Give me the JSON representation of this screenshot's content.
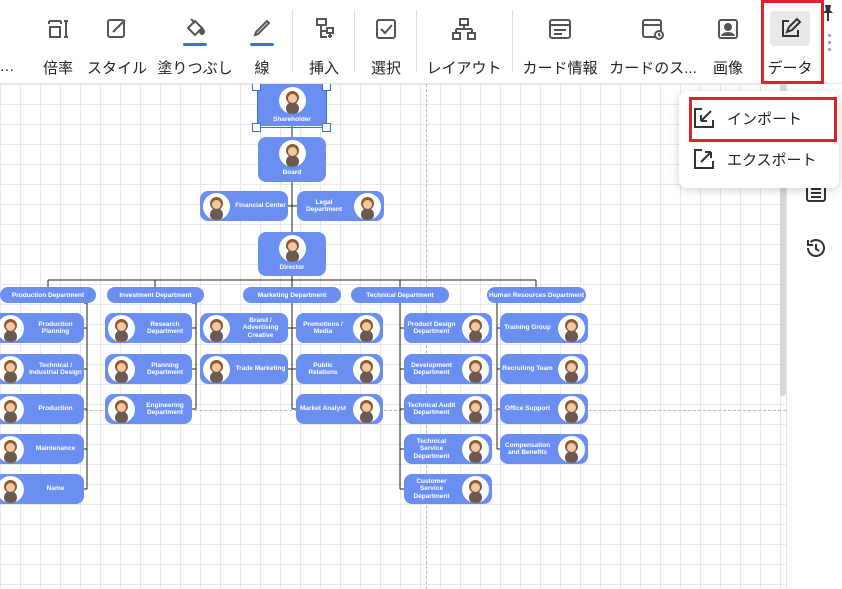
{
  "toolbar": {
    "overflow_label": "…",
    "buttons": [
      {
        "id": "scale",
        "label": "倍率"
      },
      {
        "id": "style",
        "label": "スタイル"
      },
      {
        "id": "fill",
        "label": "塗りつぶし"
      },
      {
        "id": "line",
        "label": "線"
      },
      {
        "id": "insert",
        "label": "挿入"
      },
      {
        "id": "select",
        "label": "選択"
      },
      {
        "id": "layout",
        "label": "レイアウト"
      },
      {
        "id": "card-info",
        "label": "カード情報"
      },
      {
        "id": "card-style",
        "label": "カードのス..."
      },
      {
        "id": "image",
        "label": "画像"
      },
      {
        "id": "data",
        "label": "データ"
      }
    ],
    "accent_color": "#3f6fd8",
    "highlight_color": "#e0202a"
  },
  "dropdown": {
    "items": [
      {
        "label": "インポート",
        "icon": "import-icon",
        "highlighted": true
      },
      {
        "label": "エクスポート",
        "icon": "export-icon",
        "highlighted": false
      }
    ]
  },
  "right_panel": {
    "icons": [
      "list-icon",
      "history-icon"
    ]
  },
  "org_chart": {
    "card_color": "#6b8ff0",
    "shareholder": "Shareholder",
    "board": "Board",
    "financial_center": "Financial Center",
    "legal_department": "Legal Department",
    "director": "Director",
    "departments": [
      {
        "name": "Production Department",
        "members": [
          "Production Planning",
          "Technical / Industrial Design",
          "Production",
          "Maintenance",
          "Name"
        ]
      },
      {
        "name": "Investment Department",
        "members": [
          "Research Department",
          "Planning Department",
          "Engineering Department"
        ]
      },
      {
        "name": "Marketing Department",
        "members": [
          "Brand / Advertising Creative",
          "Trade Marketing",
          "Promotions / Media",
          "Public Relations",
          "Market Analyst"
        ]
      },
      {
        "name": "Technical Department",
        "members": [
          "Product Design Department",
          "Development Department",
          "Technical Audit Department",
          "Technical Service Department",
          "Customer Service Department"
        ]
      },
      {
        "name": "Human Resources Department",
        "members": [
          "Training Group",
          "Recruiting Team",
          "Office Support",
          "Compensation and Benefits"
        ]
      }
    ]
  }
}
